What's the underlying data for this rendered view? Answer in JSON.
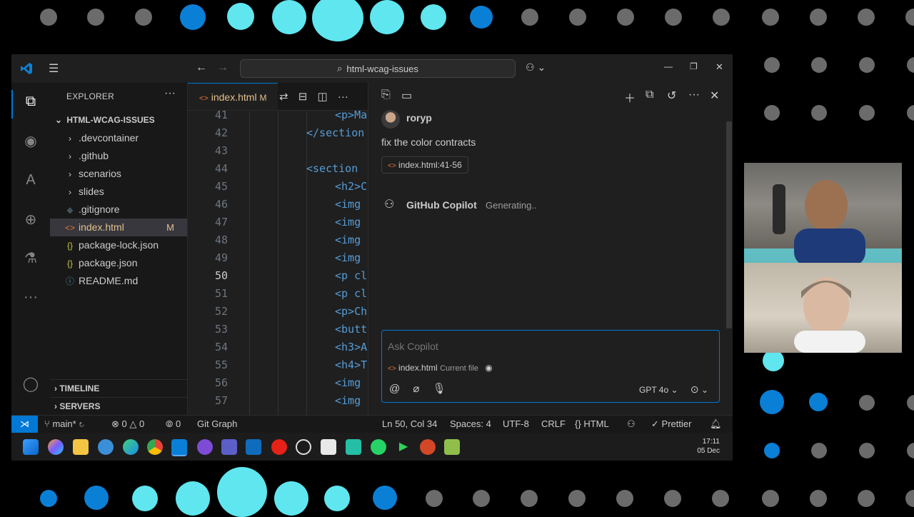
{
  "titlebar": {
    "search_text": "html-wcag-issues",
    "minimize": "—",
    "restore": "❐",
    "close": "✕"
  },
  "explorer": {
    "title": "EXPLORER",
    "more": "···",
    "root_folder": "HTML-WCAG-ISSUES",
    "items": [
      {
        "label": ".devcontainer",
        "icon": "chevron-right-icon",
        "glyph": "›"
      },
      {
        "label": ".github",
        "icon": "chevron-right-icon",
        "glyph": "›"
      },
      {
        "label": "scenarios",
        "icon": "chevron-right-icon",
        "glyph": "›"
      },
      {
        "label": "slides",
        "icon": "chevron-right-icon",
        "glyph": "›"
      },
      {
        "label": ".gitignore",
        "icon": "git-icon",
        "glyph": "◆"
      },
      {
        "label": "index.html",
        "icon": "html-icon",
        "glyph": "<>",
        "badge": "M"
      },
      {
        "label": "package-lock.json",
        "icon": "json-icon",
        "glyph": "{}"
      },
      {
        "label": "package.json",
        "icon": "json-icon",
        "glyph": "{}"
      },
      {
        "label": "README.md",
        "icon": "info-icon",
        "glyph": "ⓘ"
      }
    ],
    "timeline": "TIMELINE",
    "servers": "SERVERS"
  },
  "editor": {
    "tab_label": "index.html",
    "tab_badge": "M",
    "lines": [
      {
        "n": "41",
        "indent": 5,
        "code": "<p>Ma"
      },
      {
        "n": "42",
        "indent": 4,
        "code": "</section"
      },
      {
        "n": "43",
        "indent": 0,
        "code": ""
      },
      {
        "n": "44",
        "indent": 4,
        "code": "<section"
      },
      {
        "n": "45",
        "indent": 5,
        "code": "<h2>C"
      },
      {
        "n": "46",
        "indent": 5,
        "code": "<img"
      },
      {
        "n": "47",
        "indent": 5,
        "code": "<img"
      },
      {
        "n": "48",
        "indent": 5,
        "code": "<img"
      },
      {
        "n": "49",
        "indent": 5,
        "code": "<img"
      },
      {
        "n": "50",
        "indent": 5,
        "code": "<p cl"
      },
      {
        "n": "51",
        "indent": 5,
        "code": "<p cl"
      },
      {
        "n": "52",
        "indent": 5,
        "code": "<p>Ch"
      },
      {
        "n": "53",
        "indent": 5,
        "code": "<butt"
      },
      {
        "n": "54",
        "indent": 5,
        "code": "<h3>A"
      },
      {
        "n": "55",
        "indent": 5,
        "code": "<h4>T"
      },
      {
        "n": "56",
        "indent": 5,
        "code": "<img"
      },
      {
        "n": "57",
        "indent": 5,
        "code": "<img"
      }
    ]
  },
  "chat": {
    "user_name": "roryp",
    "user_message": "fix the color contracts",
    "reference": "index.html:41-56",
    "copilot_name": "GitHub Copilot",
    "copilot_status": "Generating..",
    "input_placeholder": "Ask Copilot",
    "context_file": "index.html",
    "context_label": "Current file",
    "model": "GPT 4o"
  },
  "statusbar": {
    "branch": "main*",
    "errors": "0",
    "warnings": "0",
    "ports": "0",
    "git_graph": "Git Graph",
    "position": "Ln 50, Col 34",
    "spaces": "Spaces: 4",
    "encoding": "UTF-8",
    "eol": "CRLF",
    "language": "HTML",
    "prettier": "Prettier"
  },
  "taskbar": {
    "time": "17:11",
    "date": "05 Dec"
  },
  "colors": {
    "accent": "#0078d4",
    "modified": "#e2c08d",
    "dot_cyan": "#5fe6ef",
    "dot_blue": "#0a7fd6"
  }
}
